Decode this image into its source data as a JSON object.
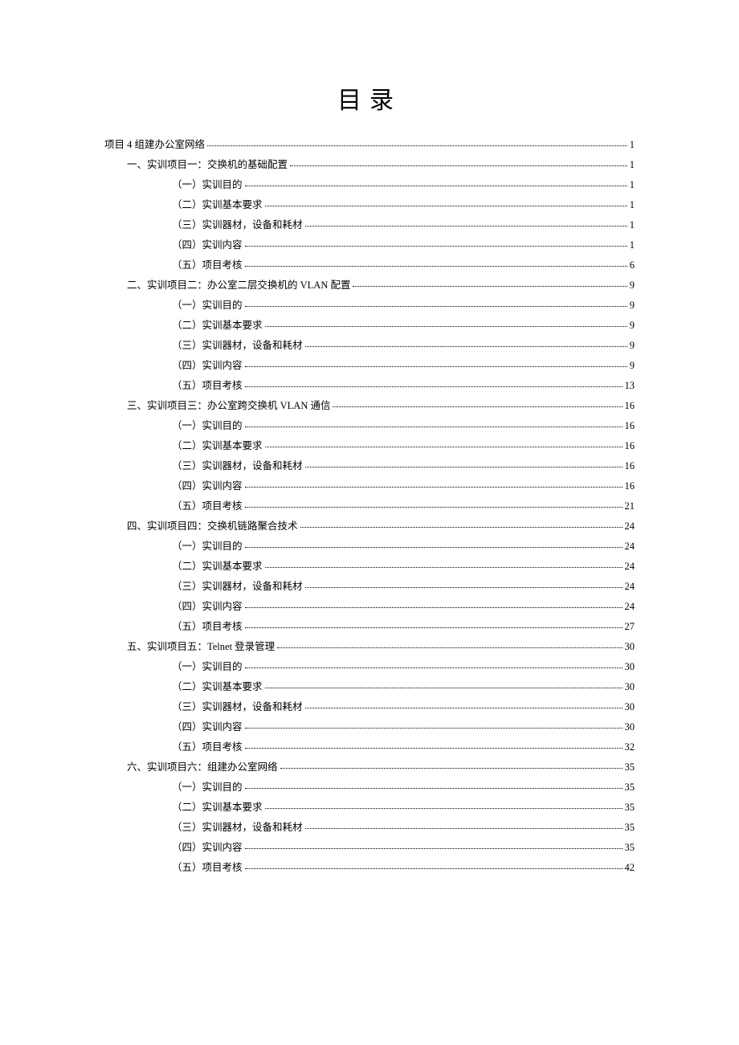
{
  "title": "目录",
  "toc": [
    {
      "level": 0,
      "label": "项目 4 组建办公室网络",
      "page": "1"
    },
    {
      "level": 1,
      "label": "一、实训项目一：交换机的基础配置",
      "page": "1"
    },
    {
      "level": 2,
      "label": "（一）实训目的",
      "page": "1"
    },
    {
      "level": 2,
      "label": "（二）实训基本要求",
      "page": "1"
    },
    {
      "level": 2,
      "label": "（三）实训器材，设备和耗材",
      "page": "1"
    },
    {
      "level": 2,
      "label": "（四）实训内容",
      "page": "1"
    },
    {
      "level": 2,
      "label": "（五）项目考核",
      "page": "6"
    },
    {
      "level": 1,
      "label": "二、实训项目二：办公室二层交换机的 VLAN 配置",
      "page": "9"
    },
    {
      "level": 2,
      "label": "（一）实训目的",
      "page": "9"
    },
    {
      "level": 2,
      "label": "（二）实训基本要求",
      "page": "9"
    },
    {
      "level": 2,
      "label": "（三）实训器材，设备和耗材",
      "page": "9"
    },
    {
      "level": 2,
      "label": "（四）实训内容",
      "page": "9"
    },
    {
      "level": 2,
      "label": "（五）项目考核",
      "page": "13"
    },
    {
      "level": 1,
      "label": "三、实训项目三：办公室跨交换机 VLAN 通信",
      "page": "16"
    },
    {
      "level": 2,
      "label": "（一）实训目的",
      "page": "16"
    },
    {
      "level": 2,
      "label": "（二）实训基本要求",
      "page": "16"
    },
    {
      "level": 2,
      "label": "（三）实训器材，设备和耗材",
      "page": "16"
    },
    {
      "level": 2,
      "label": "（四）实训内容",
      "page": "16"
    },
    {
      "level": 2,
      "label": "（五）项目考核",
      "page": "21"
    },
    {
      "level": 1,
      "label": "四、实训项目四：交换机链路聚合技术",
      "page": "24"
    },
    {
      "level": 2,
      "label": "（一）实训目的",
      "page": "24"
    },
    {
      "level": 2,
      "label": "（二）实训基本要求",
      "page": "24"
    },
    {
      "level": 2,
      "label": "（三）实训器材，设备和耗材",
      "page": "24"
    },
    {
      "level": 2,
      "label": "（四）实训内容",
      "page": "24"
    },
    {
      "level": 2,
      "label": "（五）项目考核",
      "page": "27"
    },
    {
      "level": 1,
      "label": "五、实训项目五：Telnet 登录管理",
      "page": "30"
    },
    {
      "level": 2,
      "label": "（一）实训目的",
      "page": "30"
    },
    {
      "level": 2,
      "label": "（二）实训基本要求",
      "page": "30"
    },
    {
      "level": 2,
      "label": "（三）实训器材，设备和耗材",
      "page": "30"
    },
    {
      "level": 2,
      "label": "（四）实训内容",
      "page": "30"
    },
    {
      "level": 2,
      "label": "（五）项目考核",
      "page": "32"
    },
    {
      "level": 1,
      "label": "六、实训项目六：组建办公室网络",
      "page": "35"
    },
    {
      "level": 2,
      "label": "（一）实训目的",
      "page": "35"
    },
    {
      "level": 2,
      "label": "（二）实训基本要求",
      "page": "35"
    },
    {
      "level": 2,
      "label": "（三）实训器材，设备和耗材",
      "page": "35"
    },
    {
      "level": 2,
      "label": "（四）实训内容",
      "page": "35"
    },
    {
      "level": 2,
      "label": "（五）项目考核",
      "page": "42"
    }
  ]
}
